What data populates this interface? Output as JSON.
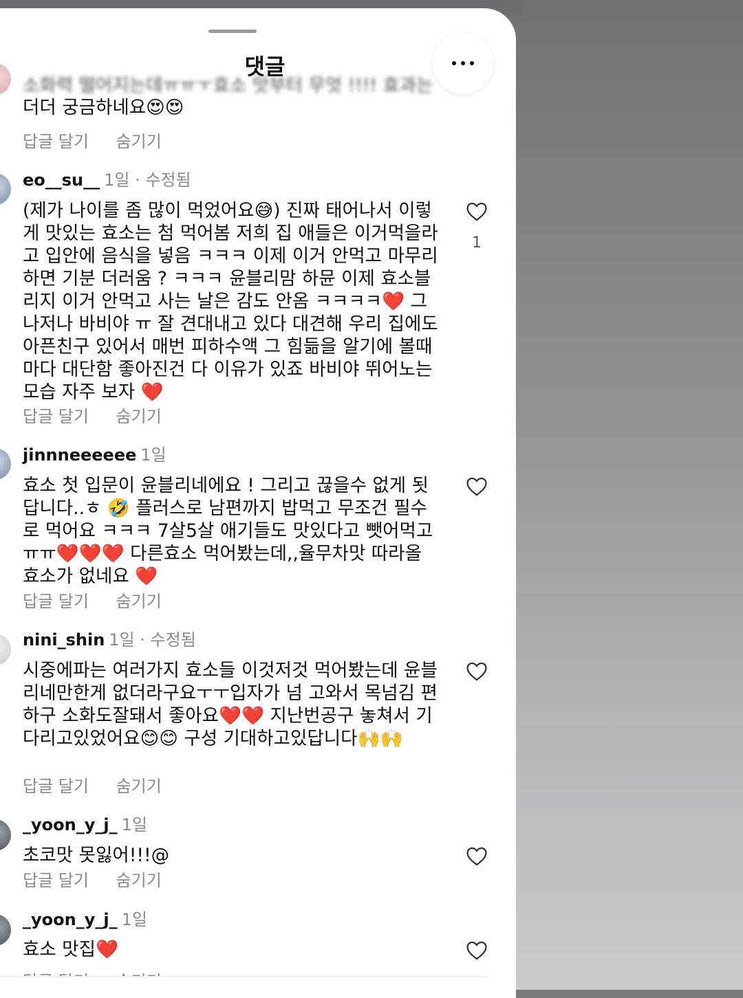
{
  "sheet": {
    "title": "댓글"
  },
  "comments": [
    {
      "user": "",
      "meta": "",
      "text_blurred": "소화력 떨어지는데ㅠㅠㅜ효소 맛부터 무엇 !!!! 효과는",
      "text": "더더 궁금하네요😍😍",
      "reply": "답글 달기",
      "hide": "숨기기"
    },
    {
      "user": "eo__su__",
      "meta": "1일 · 수정됨",
      "text": "(제가 나이를 좀 많이 먹었어요😅) 진짜 태어나서 이렇게 맛있는 효소는 첨 먹어봄 저희 집 애들은 이거먹을라고 입안에 음식을 넣음 ㅋㅋㅋ 이제 이거 안먹고 마무리하면 기분 더러움 ? ㅋㅋㅋ 윤블리맘 하뮨 이제 효소블리지 이거 안먹고 사는 날은 감도 안옴 ㅋㅋㅋㅋ❤️ 그나저나 바비야 ㅠ 잘 견대내고 있다 대견해 우리 집에도 아픈친구 있어서 매번 피하수액 그 힘듦을 알기에 볼때마다 대단함 좋아진건 다 이유가 있죠 바비야 뛰어노는 모습 자주 보자 ❤️",
      "reply": "답글 달기",
      "hide": "숨기기",
      "likes": "1"
    },
    {
      "user": "jinnneeeeee",
      "meta": "1일",
      "text": "효소 첫 입문이 윤블리네에요 ! 그리고 끊을수 없게 됫답니다..ㅎ 🤣 플러스로 남편까지 밥먹고 무조건 필수로 먹어요 ㅋㅋㅋ 7살5살 애기들도 맛있다고 뺏어먹고ㅠㅠ❤️❤️❤️ 다른효소 먹어봤는데,,율무차맛 따라올 효소가 없네요 ❤️",
      "reply": "답글 달기",
      "hide": "숨기기"
    },
    {
      "user": "nini_shin",
      "meta": "1일 · 수정됨",
      "text": "시중에파는 여러가지 효소들 이것저것 먹어봤는데 윤블리네만한게 없더라구요ㅜㅜ입자가 넘 고와서 목넘김 편하구 소화도잘돼서 좋아요❤️❤️ 지난번공구 놓쳐서 기다리고있었어요😊😊 구성 기대하고있답니다🙌🙌",
      "reply": "답글 달기",
      "hide": "숨기기"
    },
    {
      "user": "_yoon_y_j_",
      "meta": "1일",
      "text": "초코맛 못잃어!!!@",
      "reply": "답글 달기",
      "hide": "숨기기"
    },
    {
      "user": "_yoon_y_j_",
      "meta": "1일",
      "text": "효소 맛집❤️",
      "reply": "답글 달기",
      "hide": "숨기기"
    }
  ],
  "icons": {
    "more": "more-horizontal-icon",
    "like": "heart-outline-icon"
  },
  "colors": {
    "background": "#ffffff",
    "secondary_text": "#8a8a8a",
    "primary_text": "#111111"
  }
}
